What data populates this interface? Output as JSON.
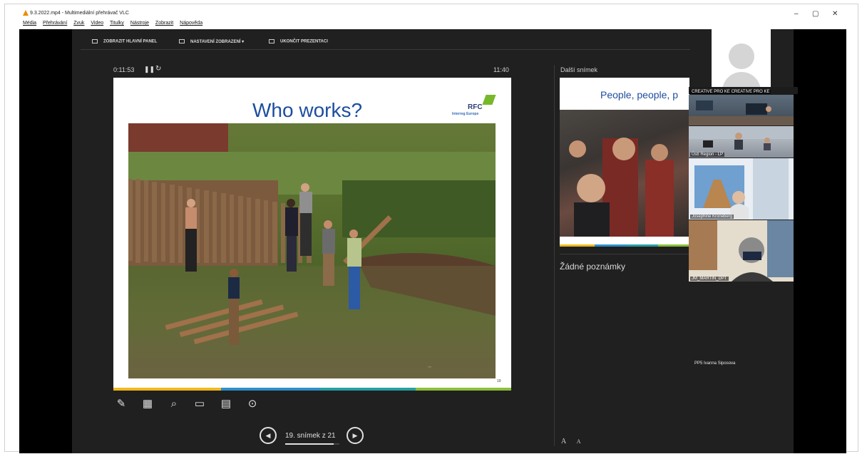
{
  "window": {
    "title": "9.3.2022.mp4 - Multimediální přehrávač VLC",
    "minimize": "–",
    "maximize": "▢",
    "close": "✕"
  },
  "menu": [
    "Média",
    "Přehrávání",
    "Zvuk",
    "Video",
    "Titulky",
    "Nástroje",
    "Zobrazit",
    "Nápověda"
  ],
  "presenter_toolbar": {
    "show_taskbar": "ZOBRAZIT HLAVNÍ PANEL",
    "display_settings": "NASTAVENÍ ZOBRAZENÍ ▾",
    "end_show": "UKONČIT PREZENTACI"
  },
  "presenter": {
    "elapsed": "0:11:53",
    "pause_icon": "pause-icon",
    "restart_icon": "restart-icon",
    "clock": "11:40",
    "next_label": "Další snímek",
    "notes": "Žádné poznámky",
    "font_larger": "A",
    "font_smaller": "A",
    "slide_counter": "19. snímek z 21"
  },
  "current_slide": {
    "title": "Who works?",
    "logo_text": "RFC",
    "logo_sub": "Interreg Europe",
    "page_number": "19",
    "photo_icon": "photo-workers"
  },
  "next_slide": {
    "title": "People, people, p"
  },
  "slide_bar_colors": [
    "#f2b81d",
    "#2d8fc9",
    "#26a0a3",
    "#8bbf3a"
  ],
  "participants": [
    {
      "label": "CREATIVE PRO KE CREATIVE PRO KE"
    },
    {
      "label": "Ústí Region - LP"
    },
    {
      "label": "Josephine Kroneberg"
    },
    {
      "label": "JM_MARTIN_DPT"
    },
    {
      "label": "PP5 Ivanna Siposova"
    }
  ]
}
